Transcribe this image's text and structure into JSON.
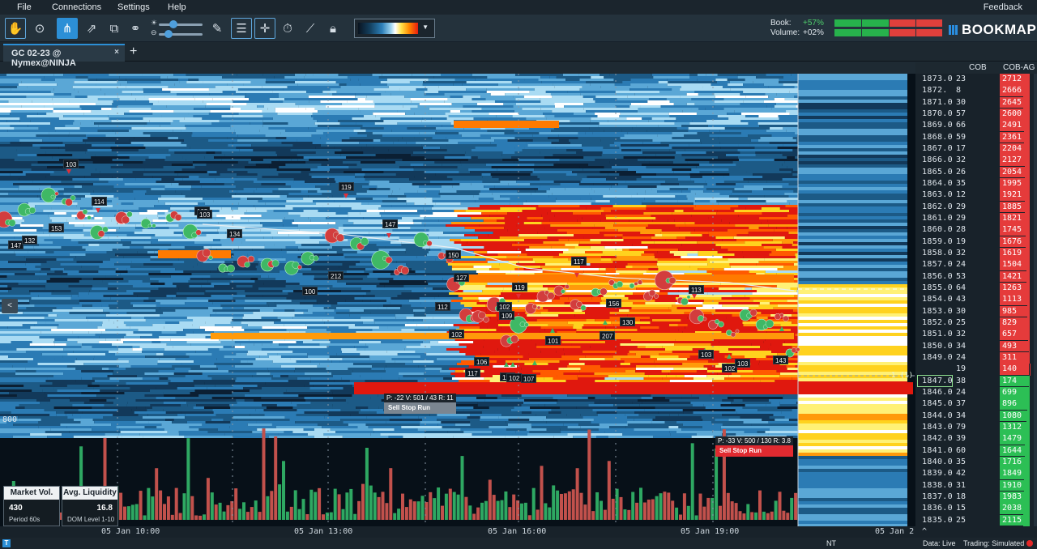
{
  "menu": {
    "file": "File",
    "connections": "Connections",
    "settings": "Settings",
    "help": "Help",
    "feedback": "Feedback"
  },
  "toolbar": {
    "tools": [
      {
        "icon": "hand-icon",
        "state": "outlined"
      },
      {
        "icon": "zoom-target-icon",
        "state": "normal"
      },
      {
        "icon": "share-nodes-icon",
        "state": "active"
      },
      {
        "icon": "rocket-icon",
        "state": "normal"
      },
      {
        "icon": "layers-icon",
        "state": "normal"
      },
      {
        "icon": "link-icon",
        "state": "normal"
      }
    ],
    "tools_right": [
      {
        "icon": "pencil-icon",
        "state": "normal"
      },
      {
        "icon": "chat-bubble-icon",
        "state": "outlined"
      },
      {
        "icon": "crosshair-icon",
        "state": "outlined"
      },
      {
        "icon": "stopwatch-icon",
        "state": "normal"
      },
      {
        "icon": "chart-line-icon",
        "state": "normal"
      },
      {
        "icon": "lock-icon",
        "state": "normal"
      }
    ],
    "brightness_level": 0.3,
    "contrast_level": 0.15
  },
  "stats": {
    "book_label": "Book:",
    "book_value": "+57%",
    "volume_label": "Volume:",
    "volume_value": "+02%"
  },
  "brand": {
    "name": "BOOKMAP",
    "accent": "#2a8ee0"
  },
  "tab": {
    "label": "GC 02-23 @ Nymex@NINJA",
    "add": "+",
    "close": "×"
  },
  "ladder": {
    "headers": {
      "cob": "COB",
      "cobag": "COB-AG"
    },
    "rows": [
      {
        "price": "1873.0",
        "cob": "23",
        "cobag": "2712"
      },
      {
        "price": "1872.",
        "cob": "8",
        "cobag": "2666"
      },
      {
        "price": "1871.0",
        "cob": "30",
        "cobag": "2645"
      },
      {
        "price": "1870.0",
        "cob": "57",
        "cobag": "2600"
      },
      {
        "price": "1869.0",
        "cob": "66",
        "cobag": "2491"
      },
      {
        "price": "1868.0",
        "cob": "59",
        "cobag": "2361"
      },
      {
        "price": "1867.0",
        "cob": "17",
        "cobag": "2204"
      },
      {
        "price": "1866.0",
        "cob": "32",
        "cobag": "2127"
      },
      {
        "price": "1865.0",
        "cob": "26",
        "cobag": "2054"
      },
      {
        "price": "1864.0",
        "cob": "35",
        "cobag": "1995"
      },
      {
        "price": "1863.0",
        "cob": "12",
        "cobag": "1921"
      },
      {
        "price": "1862.0",
        "cob": "29",
        "cobag": "1885"
      },
      {
        "price": "1861.0",
        "cob": "29",
        "cobag": "1821"
      },
      {
        "price": "1860.0",
        "cob": "28",
        "cobag": "1745"
      },
      {
        "price": "1859.0",
        "cob": "19",
        "cobag": "1676"
      },
      {
        "price": "1858.0",
        "cob": "32",
        "cobag": "1619"
      },
      {
        "price": "1857.0",
        "cob": "24",
        "cobag": "1504"
      },
      {
        "price": "1856.0",
        "cob": "53",
        "cobag": "1421"
      },
      {
        "price": "1855.0",
        "cob": "64",
        "cobag": "1263"
      },
      {
        "price": "1854.0",
        "cob": "43",
        "cobag": "1113"
      },
      {
        "price": "1853.0",
        "cob": "30",
        "cobag": "985"
      },
      {
        "price": "1852.0",
        "cob": "25",
        "cobag": "829"
      },
      {
        "price": "1851.0",
        "cob": "32",
        "cobag": "657"
      },
      {
        "price": "1850.0",
        "cob": "34",
        "cobag": "493"
      },
      {
        "price": "1849.0",
        "cob": "24",
        "cobag": "311"
      },
      {
        "price": "",
        "cob": "19",
        "cobag": "140"
      },
      {
        "price": "1847.0",
        "cob": "38",
        "cobag": "174"
      },
      {
        "price": "1846.0",
        "cob": "24",
        "cobag": "699"
      },
      {
        "price": "1845.0",
        "cob": "37",
        "cobag": "896"
      },
      {
        "price": "1844.0",
        "cob": "34",
        "cobag": "1080"
      },
      {
        "price": "1843.0",
        "cob": "79",
        "cobag": "1312"
      },
      {
        "price": "1842.0",
        "cob": "39",
        "cobag": "1479"
      },
      {
        "price": "1841.0",
        "cob": "60",
        "cobag": "1644"
      },
      {
        "price": "1840.0",
        "cob": "35",
        "cobag": "1716"
      },
      {
        "price": "1839.0",
        "cob": "42",
        "cobag": "1849"
      },
      {
        "price": "1838.0",
        "cob": "31",
        "cobag": "1910"
      },
      {
        "price": "1837.0",
        "cob": "18",
        "cobag": "1983"
      },
      {
        "price": "1836.0",
        "cob": "15",
        "cobag": "2038"
      },
      {
        "price": "1835.0",
        "cob": "25",
        "cobag": "2115"
      }
    ]
  },
  "chart": {
    "left_price_label": "800",
    "last_trade_flag": "1 (1)",
    "collapse": "<",
    "trade_labels": [
      "103",
      "114",
      "105",
      "103",
      "134",
      "119",
      "147",
      "147",
      "132",
      "153",
      "100",
      "212",
      "100",
      "150",
      "127",
      "112",
      "102",
      "106",
      "117",
      "110",
      "102",
      "107",
      "119",
      "102",
      "109",
      "101",
      "117",
      "207",
      "156",
      "130",
      "113",
      "103",
      "102",
      "103",
      "143"
    ],
    "stop_runs": [
      {
        "meta": "P: -22  V: 501 / 43  R: 11",
        "title": "Sell Stop Run"
      },
      {
        "meta": "P: -33  V: 500 / 130  R: 3.8",
        "title": "Sell Stop Run"
      }
    ]
  },
  "cards": {
    "market_vol": {
      "title": "Market Vol.",
      "value": "430",
      "sub": "Period 60s"
    },
    "avg_liquidity": {
      "title": "Avg. Liquidity",
      "value": "16.8",
      "sub": "DOM Level 1-10"
    }
  },
  "time_axis": {
    "labels": [
      "05 Jan 10:00",
      "05 Jan 13:00",
      "05 Jan 16:00",
      "05 Jan 19:00"
    ],
    "right_label": "05 Jan 2",
    "nt": "NT",
    "caret": "^"
  },
  "status": {
    "data": "Data: Live",
    "trading": "Trading: Simulated",
    "icon": "T"
  },
  "colors": {
    "bid": "#2fbf5f",
    "ask": "#e8383a",
    "accent": "#2c8fd6"
  }
}
